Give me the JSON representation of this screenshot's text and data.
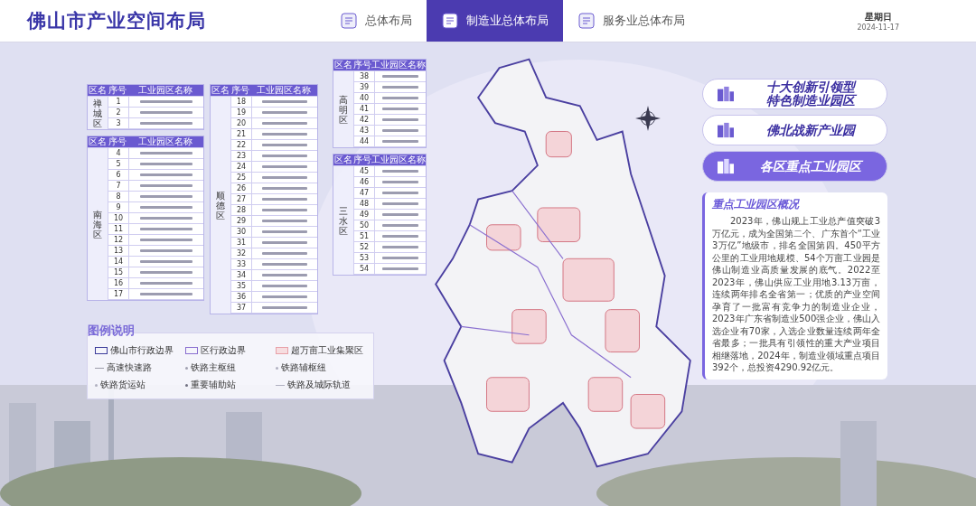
{
  "header": {
    "title": "佛山市产业空间布局",
    "tabs": [
      {
        "label": "总体布局",
        "selected": false
      },
      {
        "label": "制造业总体布局",
        "selected": true
      },
      {
        "label": "服务业总体布局",
        "selected": false
      }
    ],
    "weekday": "星期日",
    "date": "2024-11-17"
  },
  "table_groups": [
    [
      {
        "columns": [
          "区名",
          "序号",
          "工业园区名称"
        ],
        "district": "禅城区",
        "rows": [
          "1",
          "2",
          "3"
        ]
      },
      {
        "columns": [
          "区名",
          "序号",
          "工业园区名称"
        ],
        "district": "南海区",
        "rows": [
          "4",
          "5",
          "6",
          "7",
          "8",
          "9",
          "10",
          "11",
          "12",
          "13",
          "14",
          "15",
          "16",
          "17"
        ]
      }
    ],
    [
      {
        "columns": [
          "区名",
          "序号",
          "工业园区名称"
        ],
        "district": "顺德区",
        "rows": [
          "18",
          "19",
          "20",
          "21",
          "22",
          "23",
          "24",
          "25",
          "26",
          "27",
          "28",
          "29",
          "30",
          "31",
          "32",
          "33",
          "34",
          "35",
          "36",
          "37"
        ]
      }
    ],
    [
      {
        "columns": [
          "区名",
          "序号",
          "工业园区名称"
        ],
        "district": "高明区",
        "rows": [
          "38",
          "39",
          "40",
          "41",
          "42",
          "43",
          "44"
        ]
      },
      {
        "columns": [
          "区名",
          "序号",
          "工业园区名称"
        ],
        "district": "三水区",
        "rows": [
          "45",
          "46",
          "47",
          "48",
          "49",
          "50",
          "51",
          "52",
          "53",
          "54"
        ]
      }
    ]
  ],
  "legend": {
    "title": "图例说明",
    "items": [
      {
        "kind": "area",
        "label": "佛山市行政边界",
        "color": "#3b3b9a"
      },
      {
        "kind": "area",
        "label": "区行政边界",
        "color": "#8a6fd0"
      },
      {
        "kind": "fill",
        "label": "超万亩工业集聚区",
        "color": "#e8a0a8"
      },
      {
        "kind": "line",
        "label": "高速快速路",
        "color": "#9a9aa8"
      },
      {
        "kind": "dot",
        "label": "铁路主枢纽",
        "color": "#a0a0b0"
      },
      {
        "kind": "dot",
        "label": "铁路辅枢纽",
        "color": "#b0b0c0"
      },
      {
        "kind": "dot",
        "label": "铁路货运站",
        "color": "#b0b0c0"
      },
      {
        "kind": "dot",
        "label": "重要辅助站",
        "color": "#707080"
      },
      {
        "kind": "line",
        "label": "铁路及城际轨道",
        "color": "#b0b0c0"
      }
    ]
  },
  "menu": [
    {
      "lines": [
        "十大创新引领型",
        "特色制造业园区"
      ],
      "selected": false
    },
    {
      "lines": [
        "佛北战新产业园"
      ],
      "selected": false
    },
    {
      "lines": [
        "各区重点工业园区"
      ],
      "selected": true
    }
  ],
  "overview": {
    "title": "重点工业园区概况",
    "text": "2023年，佛山规上工业总产值突破3万亿元，成为全国第二个、广东首个“工业3万亿”地级市，排名全国第四。450平方公里的工业用地规模、54个万亩工业园是佛山制造业高质量发展的底气。2022至2023年，佛山供应工业用地3.13万亩，连续两年排名全省第一；优质的产业空间孕育了一批富有竞争力的制造业企业，2023年广东省制造业500强企业，佛山入选企业有70家，入选企业数量连续两年全省最多；一批具有引领性的重大产业项目相继落地，2024年，制造业领域重点项目392个，总投资4290.92亿元。"
  }
}
